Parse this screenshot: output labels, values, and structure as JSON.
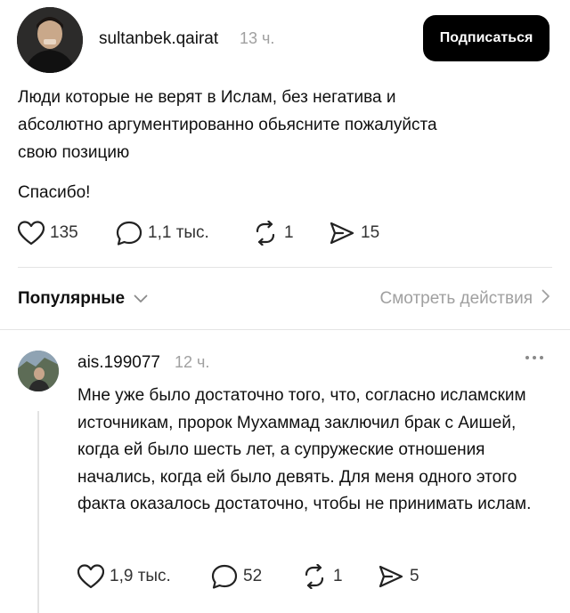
{
  "post": {
    "username": "sultanbek.qairat",
    "time": "13 ч.",
    "follow_label": "Подписаться",
    "text_line1": "Люди которые не верят в Ислам, без негатива и",
    "text_line2": "абсолютно аргументированно обьясните пожалуйста",
    "text_line3": "свою позицию",
    "text_thanks": "Спасибо!",
    "likes": "135",
    "comments": "1,1 тыс.",
    "reposts": "1",
    "shares": "15"
  },
  "sort": {
    "label": "Популярные",
    "view_activity": "Смотреть действия"
  },
  "reply": {
    "username": "ais.199077",
    "time": "12 ч.",
    "text": "Мне уже было достаточно того, что, согласно исламским источникам, пророк Мухаммад заключил брак с Аишей, когда ей было шесть лет, а супружеские отношения начались, когда ей было девять. Для меня одного этого факта оказалось достаточно, чтобы не принимать ислам.",
    "likes": "1,9 тыс.",
    "comments": "52",
    "reposts": "1",
    "shares": "5"
  },
  "icons": {
    "like": "heart-icon",
    "comment": "speech-bubble-icon",
    "repost": "repost-icon",
    "share": "send-icon",
    "more": "more-dots-icon",
    "chevron_down": "chevron-down-icon",
    "chevron_right": "chevron-right-icon"
  }
}
